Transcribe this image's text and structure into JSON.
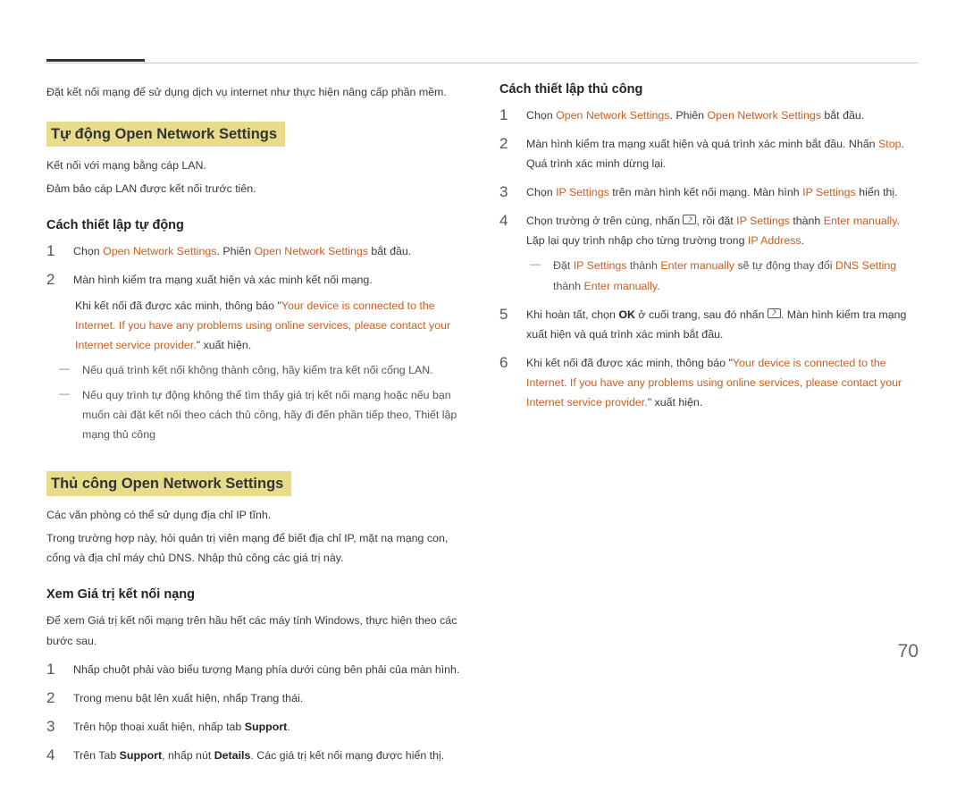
{
  "page_number": "70",
  "left": {
    "intro": "Đặt kết nối mạng để sử dụng dịch vụ internet như thực hiện nâng cấp phần mềm.",
    "auto": {
      "title": "Tự động Open Network Settings",
      "p1": "Kết nối với mạng bằng cáp LAN.",
      "p2": "Đảm bảo cáp LAN được kết nối trước tiên.",
      "sub": "Cách thiết lập tự động",
      "steps": {
        "s1_a": "Chọn ",
        "s1_b": "Open Network Settings",
        "s1_c": ". Phiên ",
        "s1_d": "Open Network Settings",
        "s1_e": " bắt đầu.",
        "s2": "Màn hình kiểm tra mạng xuất hiện và xác minh kết nối mạng.",
        "s2_note_a": "Khi kết nối đã được xác minh, thông báo \"",
        "s2_note_b": "Your device is connected to the Internet. If you have any problems using online services, please contact your Internet service provider.",
        "s2_note_c": "\" xuất hiện."
      },
      "dashes": {
        "d1": "Nếu quá trình kết nối không thành công, hãy kiểm tra kết nối cổng LAN.",
        "d2": "Nếu quy trình tự động không thể tìm thấy giá trị kết nối mạng hoặc nếu bạn muốn cài đặt kết nối theo cách thủ công, hãy đi đến phần tiếp theo, Thiết lập mạng thủ công"
      }
    },
    "manual": {
      "title": "Thủ công Open Network Settings",
      "p1": "Các văn phòng có thể sử dụng địa chỉ IP tĩnh.",
      "p2": "Trong trường hợp này, hỏi quản trị viên mạng để biết địa chỉ IP, mặt nạ mạng con, cổng và địa chỉ máy chủ DNS. Nhập thủ công các giá trị này.",
      "sub1": "Xem Giá trị kết nối nạng",
      "sub1_p": "Để xem Giá trị kết nối mạng trên hầu hết các máy tính Windows, thực hiện theo các bước sau.",
      "steps": {
        "s1": "Nhấp chuột phải vào biểu tượng Mạng phía dưới cùng bên phải của màn hình.",
        "s2": "Trong menu bật lên xuất hiện, nhấp Trạng thái.",
        "s3_a": "Trên hộp thoại xuất hiện, nhấp tab ",
        "s3_b": "Support",
        "s3_c": ".",
        "s4_a": "Trên Tab ",
        "s4_b": "Support",
        "s4_c": ", nhấp nút ",
        "s4_d": "Details",
        "s4_e": ". Các giá trị kết nối mạng được hiển thị."
      }
    }
  },
  "right": {
    "sub": "Cách thiết lập thủ công",
    "steps": {
      "s1_a": "Chọn ",
      "s1_b": "Open Network Settings",
      "s1_c": ". Phiên ",
      "s1_d": "Open Network Settings",
      "s1_e": " bắt đầu.",
      "s2_a": "Màn hình kiểm tra mạng xuất hiện và quá trình xác minh bắt đầu. Nhấn ",
      "s2_b": "Stop",
      "s2_c": ". Quá trình xác minh dừng lại.",
      "s3_a": "Chọn ",
      "s3_b": "IP Settings",
      "s3_c": " trên màn hình kết nối mạng. Màn hình ",
      "s3_d": "IP Settings",
      "s3_e": " hiển thị.",
      "s4_a": "Chọn trường ở trên cùng, nhấn ",
      "s4_b": ", rồi đặt ",
      "s4_c": "IP Settings",
      "s4_d": " thành ",
      "s4_e": "Enter manually",
      "s4_f": ". Lặp lại quy trình nhập cho từng trường trong ",
      "s4_g": "IP Address",
      "s4_h": ".",
      "dash_a": "Đặt ",
      "dash_b": "IP Settings",
      "dash_c": " thành ",
      "dash_d": "Enter manually",
      "dash_e": " sẽ tự động thay đổi ",
      "dash_f": "DNS Setting",
      "dash_g": " thành ",
      "dash_h": "Enter manually",
      "dash_i": ".",
      "s5_a": "Khi hoàn tất, chọn ",
      "s5_b": "OK",
      "s5_c": " ở cuối trang, sau đó nhấn ",
      "s5_d": ". Màn hình kiểm tra mạng xuất hiện và quá trình xác minh bắt đầu.",
      "s6_a": "Khi kết nối đã được xác minh, thông báo \"",
      "s6_b": "Your device is connected to the Internet. If you have any problems using online services, please contact your Internet service provider.",
      "s6_c": "\" xuất hiện."
    }
  }
}
